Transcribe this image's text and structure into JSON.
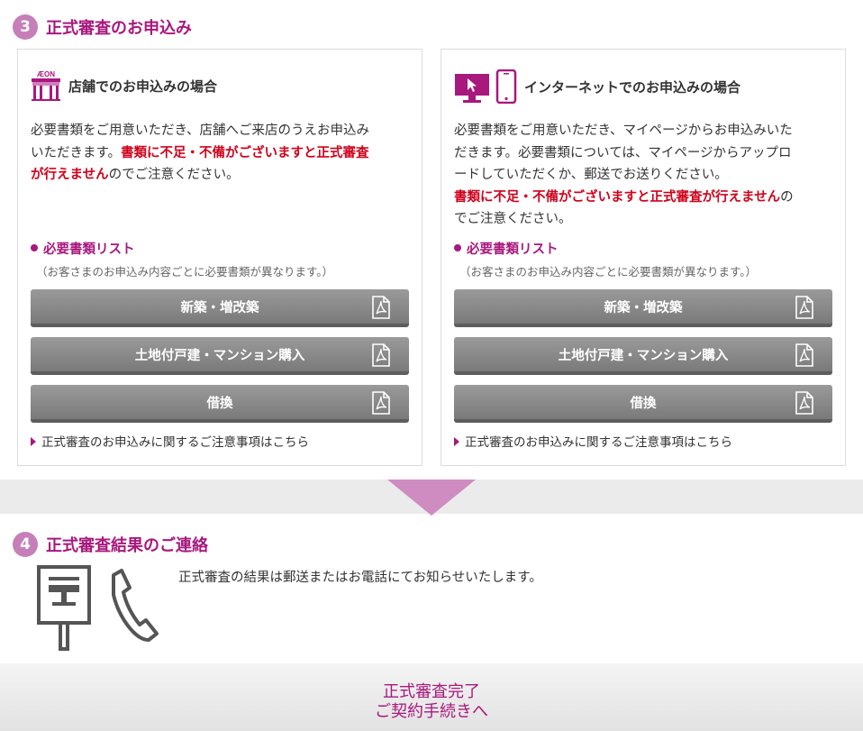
{
  "step3": {
    "number": "3",
    "title": "正式審査のお申込み"
  },
  "store_card": {
    "logo_text": "ÆON",
    "title": "店舗でのお申込みの場合",
    "desc_lines": [
      [
        {
          "t": "必要書類をご用意いただき、店舗へご来店のうえお申込み",
          "w": false
        }
      ],
      [
        {
          "t": "いただきます。",
          "w": false
        },
        {
          "t": "書類に不足・不備がございますと正式審査",
          "w": true
        }
      ],
      [
        {
          "t": "が行えません",
          "w": true
        },
        {
          "t": "のでご注意ください。",
          "w": false
        }
      ]
    ],
    "list_title": "必要書類リスト",
    "list_note": "（お客さまのお申込み内容ごとに必要書類が異なります。）",
    "buttons": [
      "新築・増改築",
      "土地付戸建・マンション購入",
      "借換"
    ],
    "notice_link": "正式審査のお申込みに関するご注意事項はこちら"
  },
  "internet_card": {
    "title": "インターネットでのお申込みの場合",
    "desc_lines": [
      [
        {
          "t": "必要書類をご用意いただき、マイページからお申込みいた",
          "w": false
        }
      ],
      [
        {
          "t": "だきます。必要書類については、マイページからアップロ",
          "w": false
        }
      ],
      [
        {
          "t": "ードしていただくか、郵送でお送りください。",
          "w": false
        }
      ],
      [
        {
          "t": "書類に不足・不備がございますと正式審査が行えません",
          "w": true
        },
        {
          "t": "の",
          "w": false
        }
      ],
      [
        {
          "t": "でご注意ください。",
          "w": false
        }
      ]
    ],
    "list_title": "必要書類リスト",
    "list_note": "（お客さまのお申込み内容ごとに必要書類が異なります。）",
    "buttons": [
      "新築・増改築",
      "土地付戸建・マンション購入",
      "借換"
    ],
    "notice_link": "正式審査のお申込みに関するご注意事項はこちら"
  },
  "step4": {
    "number": "4",
    "title": "正式審査結果のご連絡",
    "text": "正式審査の結果は郵送またはお電話にてお知らせいたします。"
  },
  "bottom": {
    "line1": "正式審査完了",
    "line2": "ご契約手続きへ"
  },
  "icons": {
    "store": "store-icon",
    "monitor": "monitor-icon",
    "smartphone": "smartphone-icon",
    "pdf": "pdf-icon",
    "postbox": "postbox-icon",
    "phone": "phone-icon"
  },
  "colors": {
    "accent": "#a8187d",
    "step_circle": "#c67fb8",
    "warning": "#d0021b",
    "arrow": "#cf8cc1",
    "button": "#8a8a8a"
  }
}
